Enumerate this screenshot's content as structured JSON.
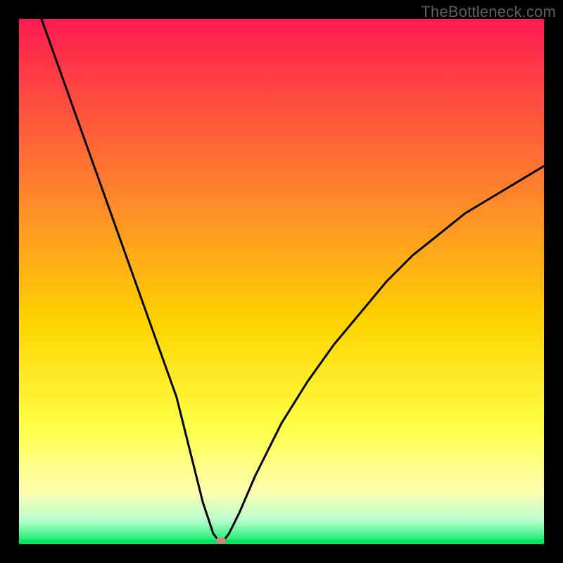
{
  "attribution": "TheBottleneck.com",
  "colors": {
    "top": "#ff1a50",
    "mid_upper": "#ff8a2a",
    "mid": "#ffd400",
    "mid_lower": "#ffff4a",
    "pale": "#ffffb0",
    "mint": "#b9ffcf",
    "green": "#00e85f",
    "curve": "#000000",
    "dot": "#d98080"
  },
  "chart_data": {
    "type": "line",
    "title": "",
    "xlabel": "",
    "ylabel": "",
    "xlim": [
      0,
      100
    ],
    "ylim": [
      0,
      100
    ],
    "series": [
      {
        "name": "bottleneck-curve",
        "x": [
          0,
          5,
          10,
          15,
          20,
          25,
          30,
          33,
          35,
          37,
          38.5,
          40,
          42,
          45,
          50,
          55,
          60,
          65,
          70,
          75,
          80,
          85,
          90,
          95,
          100
        ],
        "y": [
          112,
          98,
          84,
          70,
          56,
          42,
          28,
          16,
          8,
          2,
          0,
          2,
          6,
          13,
          23,
          31,
          38,
          44,
          50,
          55,
          59,
          63,
          66,
          69,
          72
        ]
      }
    ],
    "marker": {
      "x": 38.5,
      "y": 0
    },
    "gradient_stops": [
      {
        "pos": 0.0,
        "color": "#ff1a50"
      },
      {
        "pos": 0.35,
        "color": "#ff8a2a"
      },
      {
        "pos": 0.58,
        "color": "#ffd400"
      },
      {
        "pos": 0.78,
        "color": "#ffff4a"
      },
      {
        "pos": 0.9,
        "color": "#ffffb0"
      },
      {
        "pos": 0.955,
        "color": "#b9ffcf"
      },
      {
        "pos": 1.0,
        "color": "#00e85f"
      }
    ]
  }
}
